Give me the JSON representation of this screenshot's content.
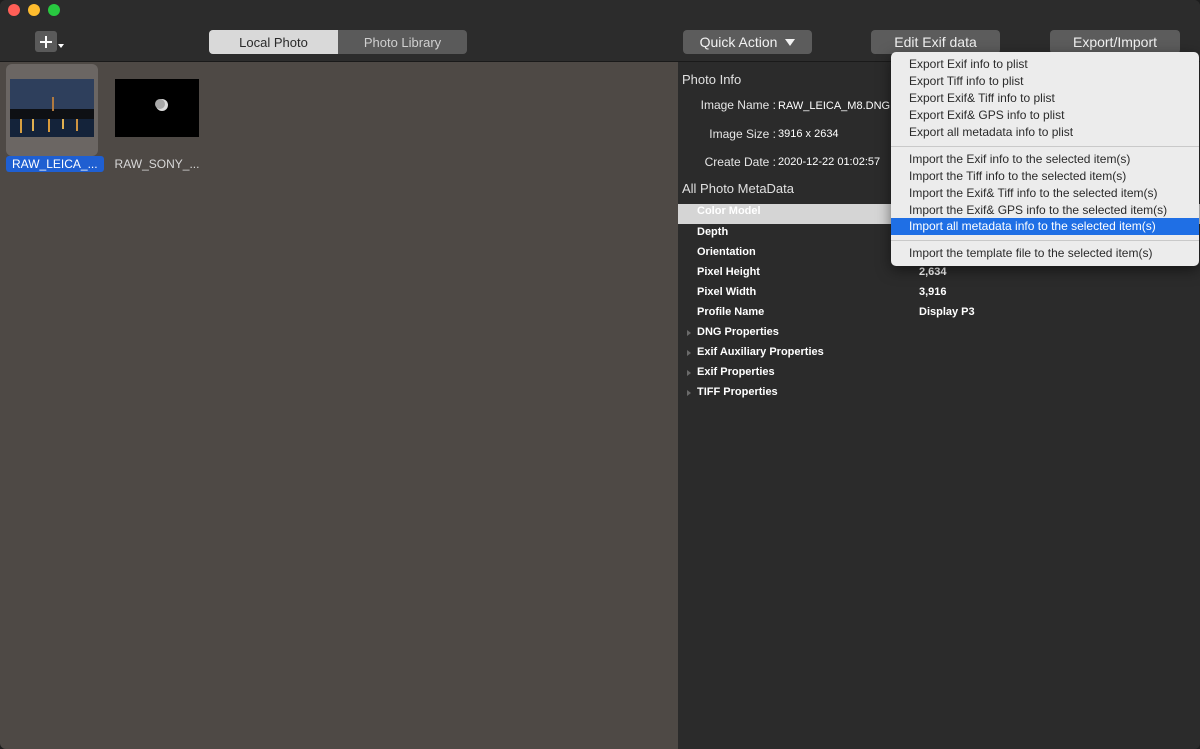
{
  "toolbar": {
    "add_icon": "plus-icon",
    "segments": [
      "Local Photo",
      "Photo Library"
    ],
    "active_segment": "Local Photo",
    "quick_action_label": "Quick Action",
    "edit_exif_label": "Edit Exif data",
    "export_import_label": "Export/Import"
  },
  "browser": {
    "items": [
      {
        "label": "RAW_LEICA_...",
        "selected": true
      },
      {
        "label": "RAW_SONY_...",
        "selected": false
      }
    ]
  },
  "photo_info": {
    "section_title": "Photo Info",
    "image_name_label": "Image Name :",
    "image_name_value": "RAW_LEICA_M8.DNG",
    "image_size_label": "Image Size :",
    "image_size_value": "3916 x 2634",
    "create_date_label": "Create Date :",
    "create_date_value": "2020-12-22 01:02:57"
  },
  "metadata": {
    "section_title": "All Photo MetaData",
    "header_first": "Color Model",
    "rows": [
      {
        "key": "Depth",
        "value": ""
      },
      {
        "key": "Orientation",
        "value": ""
      },
      {
        "key": "Pixel Height",
        "value": "2,634"
      },
      {
        "key": "Pixel Width",
        "value": "3,916"
      },
      {
        "key": "Profile Name",
        "value": "Display P3"
      }
    ],
    "groups": [
      "DNG Properties",
      "Exif Auxiliary Properties",
      "Exif Properties",
      "TIFF Properties"
    ]
  },
  "menu": {
    "export_items": [
      "Export Exif info to plist",
      "Export Tiff info to plist",
      "Export Exif& Tiff info to plist",
      "Export Exif& GPS info to plist",
      "Export all metadata info to plist"
    ],
    "import_items": [
      "Import the Exif info to the selected item(s)",
      "Import the Tiff info to the selected item(s)",
      "Import the Exif& Tiff info to the selected item(s)",
      "Import the Exif& GPS info to the selected item(s)",
      "Import all metadata info to the selected item(s)"
    ],
    "highlighted": "Import all metadata info to the selected item(s)",
    "template_item": "Import the template file to the selected item(s)"
  },
  "colors": {
    "accent": "#1f6fe5",
    "browser_bg": "#4e4945",
    "inspector_bg": "#2b2b2b"
  }
}
